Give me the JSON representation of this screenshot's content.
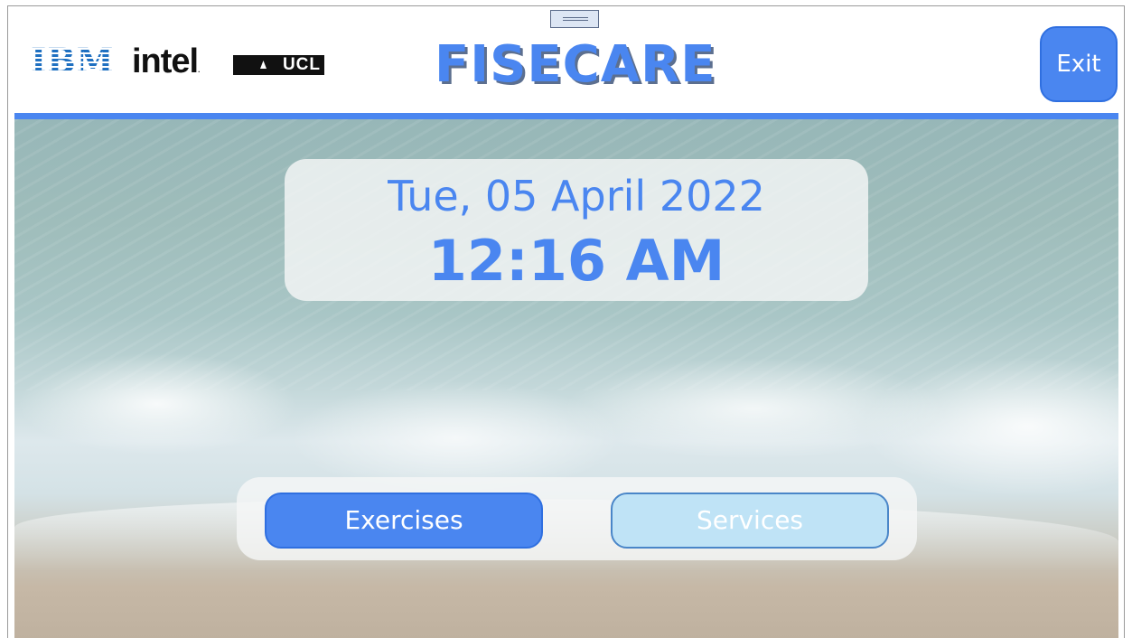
{
  "header": {
    "logos": {
      "ibm": "IBM",
      "intel": "intel",
      "intel_mark": ".",
      "ucl": "UCL"
    },
    "app_title": "FISECARE",
    "exit_label": "Exit"
  },
  "clock": {
    "date": "Tue, 05 April 2022",
    "time": "12:16 AM"
  },
  "nav": {
    "exercises_label": "Exercises",
    "services_label": "Services"
  },
  "colors": {
    "accent": "#4a86f0",
    "accent_light": "#bfe3f6",
    "title_shadow": "#5c6f8f"
  },
  "icons": {
    "drag_handle": "drag-handle-icon"
  }
}
